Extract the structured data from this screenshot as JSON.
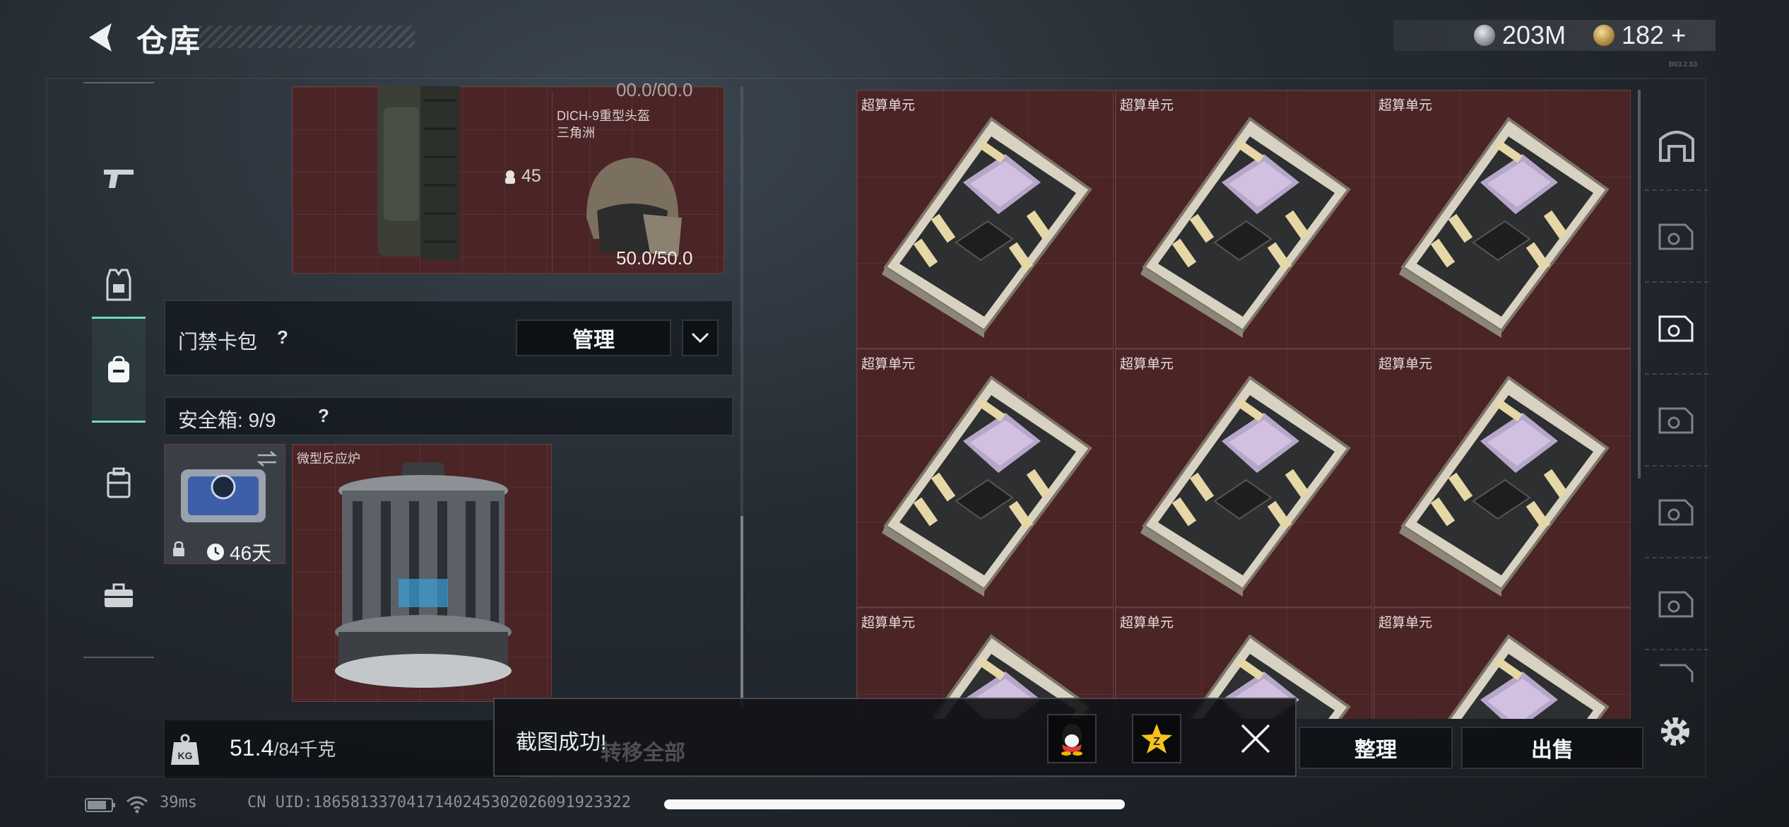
{
  "header": {
    "title": "仓库",
    "currency_silver": "203M",
    "currency_gold": "182",
    "add_symbol": "+",
    "version": "B93.2.83"
  },
  "left_items": {
    "top_slot_durability_partial": "00.0/00.0",
    "helmet_name": "DICH-9重型头盔",
    "helmet_map": "三角洲",
    "armor_count": "45",
    "helmet_durability": "50.0/50.0"
  },
  "keycard": {
    "label": "门禁卡包",
    "help": "?",
    "manage_label": "管理"
  },
  "safebox": {
    "label": "安全箱: 9/9",
    "help": "?",
    "days_left": "46天",
    "item_name": "微型反应炉"
  },
  "grid": {
    "item_label": "超算单元"
  },
  "bottom": {
    "weight_value": "51.4",
    "weight_max": "/84千克",
    "kg_label": "KG",
    "transfer_all": "转移全部",
    "sort_label": "整理",
    "sell_label": "出售"
  },
  "toast": {
    "message": "截图成功!"
  },
  "status": {
    "ping": "39ms",
    "uid": "CN UID:1865813370417140245302026091923322"
  }
}
